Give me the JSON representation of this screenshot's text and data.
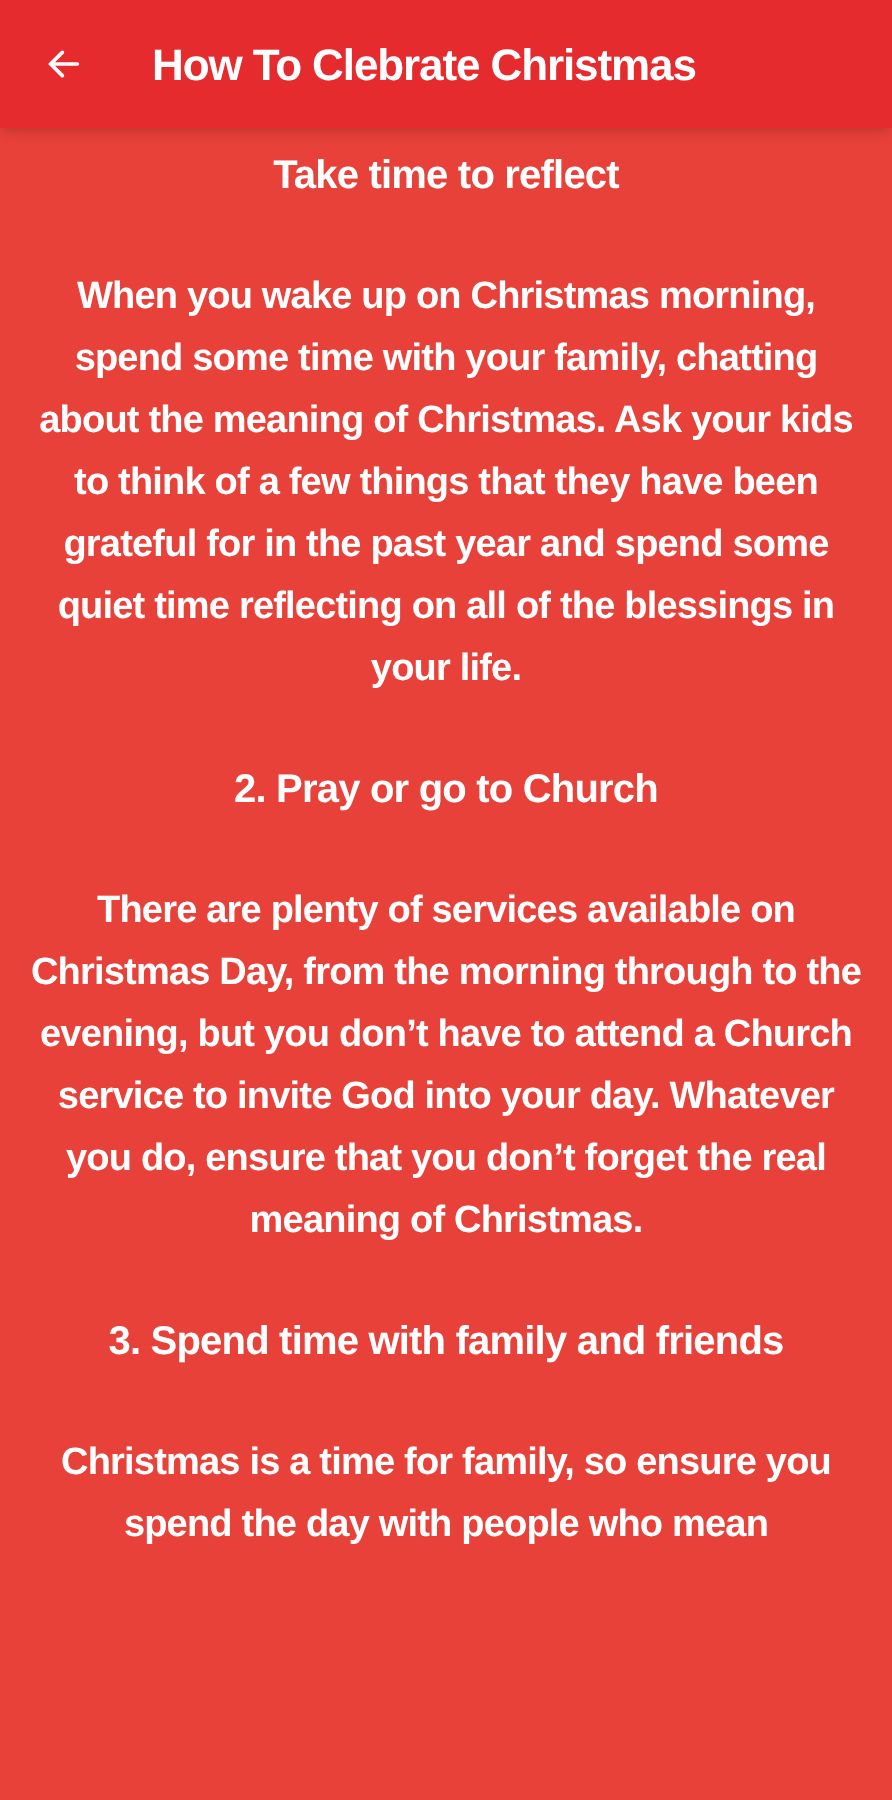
{
  "app_bar": {
    "title": "How To Clebrate Christmas"
  },
  "blocks": [
    {
      "kind": "heading",
      "text": "Take time to reflect"
    },
    {
      "kind": "paragraph",
      "text": "When you wake up on Christmas morning, spend some time with your family, chatting about the meaning of Christmas. Ask your kids to think of a few things that they have been grateful for in the past year and spend some quiet time reflecting on all of the blessings in your life."
    },
    {
      "kind": "heading",
      "text": "2.  Pray or go to Church"
    },
    {
      "kind": "paragraph",
      "text": "There are plenty of services available on Christmas Day, from the morning through to the evening, but you don’t have to attend a Church service to invite God into your day. Whatever you do, ensure that you don’t forget the real meaning of Christmas."
    },
    {
      "kind": "heading",
      "text": "3.  Spend time with family and friends"
    },
    {
      "kind": "paragraph",
      "text": "Christmas is a time for family, so ensure you spend the day with people who mean"
    }
  ]
}
